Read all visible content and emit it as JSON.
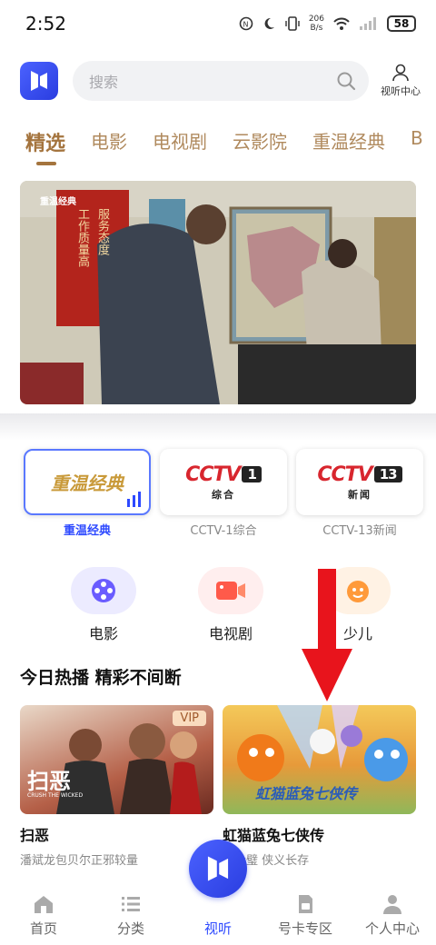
{
  "status_bar": {
    "time": "2:52",
    "speed_top": "206",
    "speed_unit": "B/s",
    "battery": "58",
    "icons": [
      "nfc-icon",
      "moon-icon",
      "vibrate-icon",
      "wifi-icon",
      "signal-icon",
      "battery-icon"
    ]
  },
  "header": {
    "search_placeholder": "搜索",
    "user_center_label": "视听中心"
  },
  "tabs": [
    {
      "label": "精选",
      "active": true
    },
    {
      "label": "电影",
      "active": false
    },
    {
      "label": "电视剧",
      "active": false
    },
    {
      "label": "云影院",
      "active": false
    },
    {
      "label": "重温经典",
      "active": false
    },
    {
      "label": "B",
      "active": false
    }
  ],
  "banner": {
    "channel_badge": "重温经典",
    "banner_text": {
      "banner_1": "服",
      "banner_2": "务",
      "banner_3": "态",
      "banner_4": "度",
      "banner_5": "工",
      "banner_6": "作",
      "banner_7": "质",
      "banner_8": "量",
      "banner_9": "高"
    }
  },
  "channels": [
    {
      "label": "重温经典",
      "logo_text": "重温经典",
      "active": true
    },
    {
      "label": "CCTV-1综合",
      "logo_main": "CCTV",
      "logo_num": "1",
      "logo_sub": "综合",
      "active": false
    },
    {
      "label": "CCTV-13新闻",
      "logo_main": "CCTV",
      "logo_num": "13",
      "logo_sub": "新闻",
      "active": false
    }
  ],
  "categories": [
    {
      "label": "电影",
      "icon": "film-reel-icon",
      "color": "#6a5cff"
    },
    {
      "label": "电视剧",
      "icon": "video-camera-icon",
      "color": "#ff5a4a"
    },
    {
      "label": "少儿",
      "icon": "kids-icon",
      "color": "#ff9a3a"
    }
  ],
  "section": {
    "title": "今日热播 精彩不间断"
  },
  "shows": [
    {
      "title": "扫恶",
      "desc": "潘斌龙包贝尔正邪较量",
      "badge": "VIP",
      "thumb_text": "扫恶",
      "thumb_sub": "CRUSH THE WICKED"
    },
    {
      "title": "虹猫蓝兔七侠传",
      "desc": "剑合璧 侠义长存",
      "thumb_text": "虹猫蓝兔七侠传"
    }
  ],
  "bottom_nav": [
    {
      "label": "首页",
      "icon": "home-icon",
      "active": false
    },
    {
      "label": "分类",
      "icon": "list-icon",
      "active": false
    },
    {
      "label": "视听",
      "icon": "play-logo-icon",
      "active": true
    },
    {
      "label": "号卡专区",
      "icon": "sim-card-icon",
      "active": false
    },
    {
      "label": "个人中心",
      "icon": "person-icon",
      "active": false
    }
  ],
  "colors": {
    "accent": "#2d49ff",
    "tab_gold": "#a4743e",
    "arrow_red": "#e8141c"
  }
}
